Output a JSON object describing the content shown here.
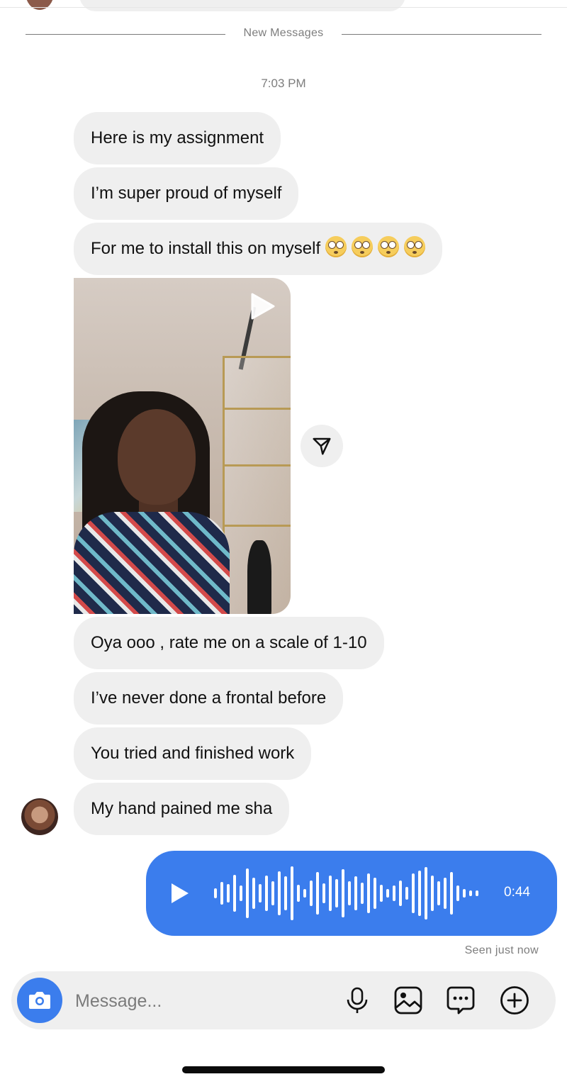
{
  "divider": {
    "label": "New Messages"
  },
  "timestamp": "7:03 PM",
  "messages_before_video": [
    {
      "text": "Here is my assignment"
    },
    {
      "text": "I’m super proud of myself"
    },
    {
      "text": "For me to install this on myself",
      "emoji_count": 4,
      "emoji": "flushed-face"
    }
  ],
  "video": {
    "icon": "play-icon",
    "share_icon": "send-icon"
  },
  "messages_after_video": [
    {
      "text": "Oya ooo , rate me on a scale of 1-10"
    },
    {
      "text": "I’ve never done a frontal before"
    },
    {
      "text": "You tried and finished work"
    },
    {
      "text": "My hand pained me sha"
    }
  ],
  "voice_message": {
    "duration": "0:44",
    "color": "#3b7ded"
  },
  "status": "Seen just now",
  "composer": {
    "placeholder": "Message...",
    "icons": [
      "camera-icon",
      "microphone-icon",
      "gallery-icon",
      "sticker-chat-icon",
      "add-icon"
    ]
  }
}
